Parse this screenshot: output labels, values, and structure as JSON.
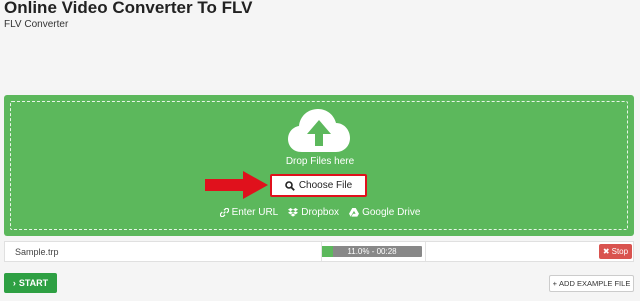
{
  "header": {
    "title": "Online Video Converter To FLV",
    "subtitle": "FLV Converter"
  },
  "dropzone": {
    "icon": "cloud-upload-icon",
    "drop_label": "Drop Files here",
    "choose_label": "Choose File",
    "links": [
      {
        "icon": "link-icon",
        "label": "Enter URL"
      },
      {
        "icon": "dropbox-icon",
        "label": "Dropbox"
      },
      {
        "icon": "google-drive-icon",
        "label": "Google Drive"
      }
    ],
    "accent_color": "#5cb85c",
    "highlight_color": "#e0111c"
  },
  "file": {
    "name": "Sample.trp",
    "progress_text": "11.0% - 00:28",
    "progress": 0.11,
    "stop_label": "Stop"
  },
  "actions": {
    "start_label": "START",
    "example_label": "ADD EXAMPLE FILE"
  }
}
